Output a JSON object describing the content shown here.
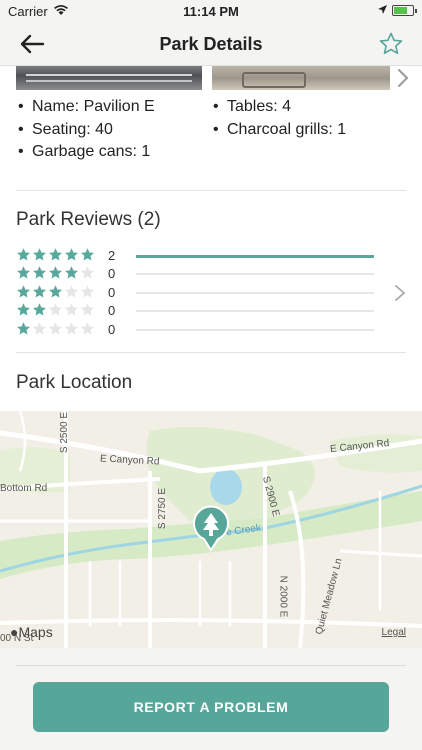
{
  "status_bar": {
    "carrier": "Carrier",
    "time": "11:14 PM"
  },
  "nav": {
    "title": "Park Details"
  },
  "details": {
    "left": [
      "Name: Pavilion E",
      "Seating: 40",
      "Garbage cans: 1"
    ],
    "right": [
      "Tables: 4",
      "Charcoal grills: 1"
    ]
  },
  "reviews": {
    "title": "Park Reviews (2)",
    "rows": [
      {
        "stars": 5,
        "count": "2",
        "fraction": 1.0
      },
      {
        "stars": 4,
        "count": "0",
        "fraction": 0
      },
      {
        "stars": 3,
        "count": "0",
        "fraction": 0
      },
      {
        "stars": 2,
        "count": "0",
        "fraction": 0
      },
      {
        "stars": 1,
        "count": "0",
        "fraction": 0
      }
    ]
  },
  "location": {
    "title": "Park Location",
    "map_labels": {
      "canyon_rd_1": "E Canyon Rd",
      "canyon_rd_2": "E Canyon Rd",
      "bottom_rd": "Bottom Rd",
      "s2750": "S 2750 E",
      "s2500": "S 2500 E",
      "s2900": "S 2900 E",
      "n2000": "N 2000 E",
      "quiet_meadow": "Quiet Meadow Ln",
      "creek": "e Creek",
      "n_st": "00 N St"
    },
    "maps_brand": "Maps",
    "legal": "Legal"
  },
  "report_button": "REPORT A PROBLEM",
  "colors": {
    "accent": "#57a69a",
    "star_filled": "#5aa89b",
    "star_empty": "#e6e6e6"
  }
}
